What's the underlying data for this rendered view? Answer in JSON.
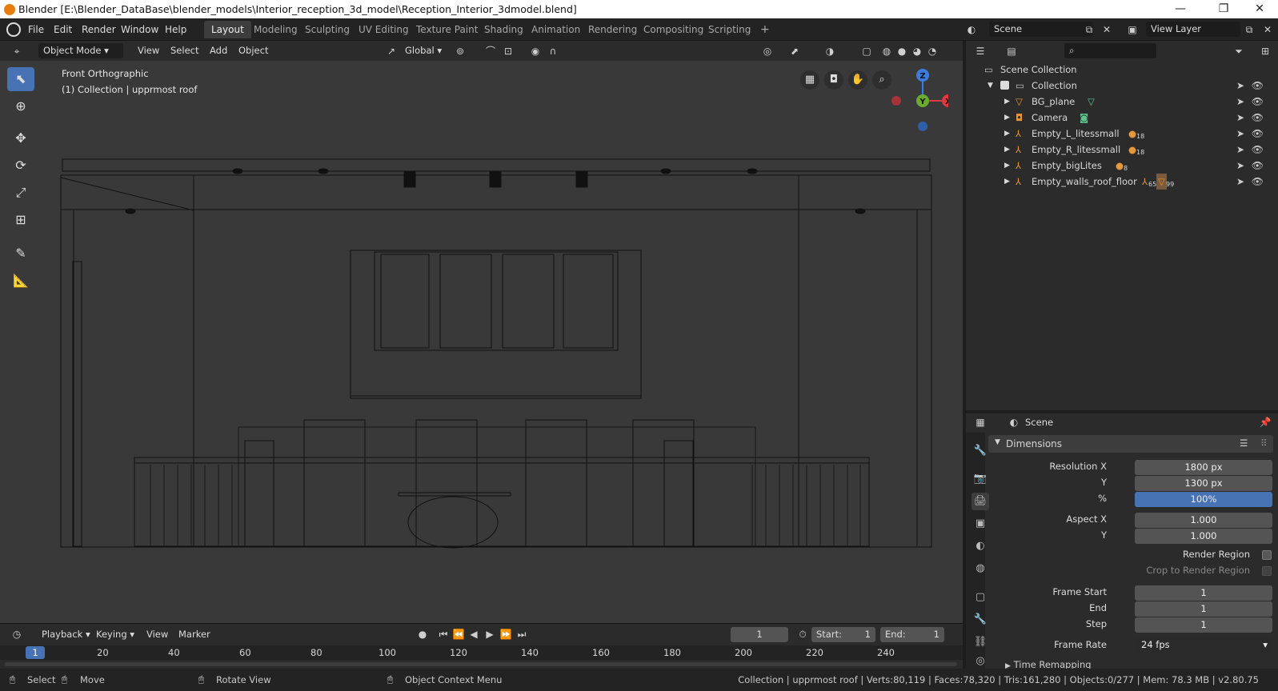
{
  "window": {
    "title": "Blender [E:\\Blender_DataBase\\blender_models\\Interior_reception_3d_model\\Reception_Interior_3dmodel.blend]",
    "minimize": "—",
    "restore": "❐",
    "close": "✕"
  },
  "menu": [
    "File",
    "Edit",
    "Render",
    "Window",
    "Help"
  ],
  "workspaces": [
    "Layout",
    "Modeling",
    "Sculpting",
    "UV Editing",
    "Texture Paint",
    "Shading",
    "Animation",
    "Rendering",
    "Compositing",
    "Scripting"
  ],
  "add_workspace": "+",
  "scene_field": "Scene",
  "view_layer_field": "View Layer",
  "viewport": {
    "mode": "Object Mode",
    "menus": [
      "View",
      "Select",
      "Add",
      "Object"
    ],
    "transform_orientation": "Global",
    "view_name": "Front Orthographic",
    "collection_info": "(1) Collection | upprmost roof",
    "gizmo": {
      "z": "Z",
      "y": "Y",
      "x": "X"
    }
  },
  "outliner": {
    "root": "Scene Collection",
    "collection": "Collection",
    "items": [
      {
        "name": "BG_plane",
        "type": "mesh"
      },
      {
        "name": "Camera",
        "type": "camera"
      },
      {
        "name": "Empty_L_litessmall",
        "badge": "18"
      },
      {
        "name": "Empty_R_litessmall",
        "badge": "18"
      },
      {
        "name": "Empty_bigLites",
        "badge": "8"
      },
      {
        "name": "Empty_walls_roof_floor",
        "badge": "65",
        "badge2": "99"
      }
    ]
  },
  "properties": {
    "context": "Scene",
    "panel": "Dimensions",
    "fields": [
      {
        "label": "Resolution X",
        "value": "1800 px"
      },
      {
        "label": "Y",
        "value": "1300 px"
      },
      {
        "label": "%",
        "value": "100%"
      },
      {
        "label": "Aspect X",
        "value": "1.000"
      },
      {
        "label": "Y",
        "value": "1.000"
      }
    ],
    "render_region": "Render Region",
    "crop": "Crop to Render Region",
    "frames": [
      {
        "label": "Frame Start",
        "value": "1"
      },
      {
        "label": "End",
        "value": "1"
      },
      {
        "label": "Step",
        "value": "1"
      }
    ],
    "frame_rate_label": "Frame Rate",
    "frame_rate": "24 fps",
    "time_remapping": "Time Remapping"
  },
  "timeline": {
    "menus": [
      "Playback",
      "Keying",
      "View",
      "Marker"
    ],
    "current_frame": "1",
    "start_label": "Start:",
    "start": "1",
    "end_label": "End:",
    "end": "1",
    "ticks": [
      "1",
      "20",
      "40",
      "60",
      "80",
      "100",
      "120",
      "140",
      "160",
      "180",
      "200",
      "220",
      "240"
    ]
  },
  "status": {
    "select": "Select",
    "move": "Move",
    "rotate": "Rotate View",
    "context": "Object Context Menu",
    "stats": "Collection | upprmost roof | Verts:80,119 | Faces:78,320 | Tris:161,280 | Objects:0/277 | Mem: 78.3 MB | v2.80.75"
  },
  "colors": {
    "accent": "#4772b3",
    "x_axis": "#e0383f",
    "y_axis": "#6aaa2f",
    "z_axis": "#3b7ddd",
    "object_orange": "#e8963a"
  }
}
